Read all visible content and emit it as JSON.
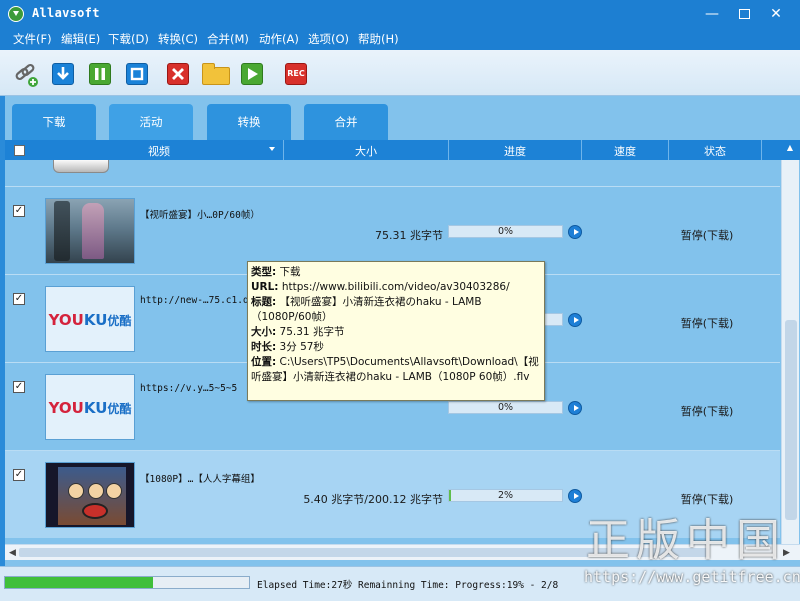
{
  "window": {
    "title": "Allavsoft"
  },
  "menu": [
    "文件(F)",
    "编辑(E)",
    "下载(D)",
    "转换(C)",
    "合并(M)",
    "动作(A)",
    "选项(O)",
    "帮助(H)"
  ],
  "toolbar": {
    "icons": [
      "link-add-icon",
      "download-icon",
      "pause-icon",
      "stop-icon",
      "delete-icon",
      "folder-icon",
      "play-icon",
      "rec-icon"
    ],
    "rec_label": "REC"
  },
  "tabs": [
    "下载",
    "活动",
    "转换",
    "合并"
  ],
  "columns": [
    "视频",
    "大小",
    "进度",
    "速度",
    "状态"
  ],
  "rows": [
    {
      "title": "【视听盛宴】小…0P/60帧）",
      "size": "75.31 兆字节",
      "progress": "0%",
      "status": "暂停(下载)",
      "checked": true
    },
    {
      "title": "http://new-…75.c1.d",
      "size": "",
      "progress": "",
      "status": "暂停(下载)",
      "checked": true
    },
    {
      "title": "https://v.y…5~5~5",
      "size": "",
      "progress": "0%",
      "status": "暂停(下载)",
      "checked": true
    },
    {
      "title": "【1080P】…【人人字幕组】",
      "size": "5.40 兆字节/200.12 兆字节",
      "progress": "2%",
      "status": "暂停(下载)",
      "checked": true
    }
  ],
  "tooltip": {
    "type_label": "类型:",
    "type_value": "下载",
    "url_label": "URL:",
    "url_value": "https://www.bilibili.com/video/av30403286/",
    "title_label": "标题:",
    "title_value": "【视听盛宴】小清新连衣裙のhaku - LAMB（1080P/60帧）",
    "size_label": "大小:",
    "size_value": "75.31 兆字节",
    "duration_label": "时长:",
    "duration_value": "3分 57秒",
    "location_label": "位置:",
    "location_value": "C:\\Users\\TP5\\Documents\\Allavsoft\\Download\\【视听盛宴】小清新连衣裙のhaku - LAMB（1080P 60帧）.flv"
  },
  "status_bar": {
    "text": "Elapsed Time:27秒 Remainning Time: Progress:19% - 2/8",
    "progress_fraction": 0.19
  },
  "watermark": {
    "cn": "正版中国",
    "url": "https://www.getitfree.cn"
  },
  "colors": {
    "accent": "#1d7fd2",
    "list_bg": "#82c2ec",
    "progress_fill": "#5fbe4b"
  }
}
